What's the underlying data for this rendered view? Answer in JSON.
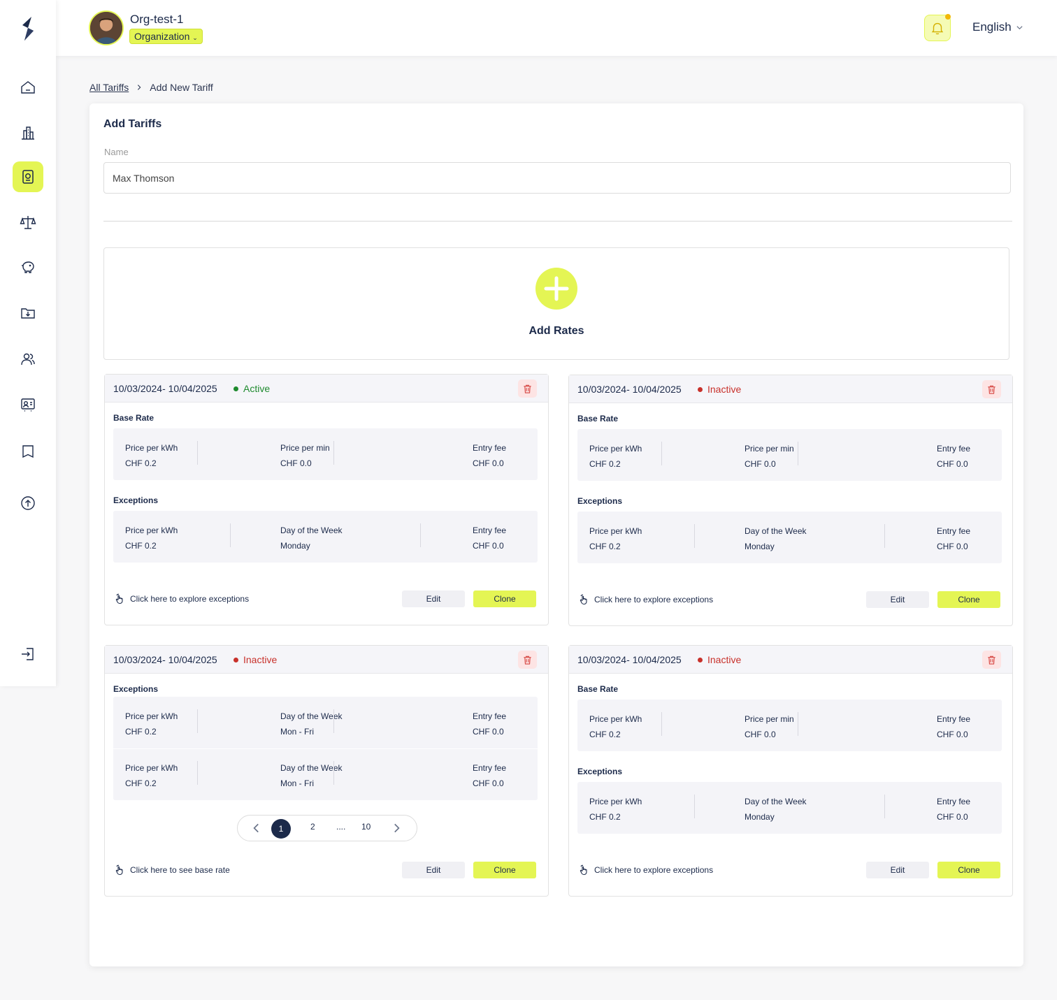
{
  "header": {
    "org_name": "Org-test-1",
    "org_type": "Organization",
    "language": "English"
  },
  "breadcrumb": {
    "parent": "All Tariffs",
    "current": "Add New Tariff"
  },
  "form": {
    "title": "Add Tariffs",
    "name_label": "Name",
    "name_value": "Max Thomson",
    "add_rates_label": "Add Rates"
  },
  "colors": {
    "accent": "#e4f554",
    "navy": "#1c2a4a",
    "active": "#1e8a2e",
    "inactive": "#c8312b"
  },
  "cards": [
    {
      "date_range": "10/03/2024- 10/04/2025",
      "status": "Active",
      "base_rate": {
        "label": "Base Rate",
        "col1_label": "Price per kWh",
        "col1_value": "CHF 0.2",
        "col2_label": "Price per min",
        "col2_value": "CHF 0.0",
        "col3_label": "Entry fee",
        "col3_value": "CHF 0.0"
      },
      "exceptions": {
        "label": "Exceptions",
        "col1_label": "Price per kWh",
        "col1_value": "CHF 0.2",
        "col2_label": "Day of the Week",
        "col2_value": "Monday",
        "col3_label": "Entry fee",
        "col3_value": "CHF 0.0"
      },
      "link_text": "Click here to explore exceptions",
      "edit_label": "Edit",
      "clone_label": "Clone"
    },
    {
      "date_range": "10/03/2024- 10/04/2025",
      "status": "Inactive",
      "base_rate": {
        "label": "Base Rate",
        "col1_label": "Price per kWh",
        "col1_value": "CHF 0.2",
        "col2_label": "Price per min",
        "col2_value": "CHF 0.0",
        "col3_label": "Entry fee",
        "col3_value": "CHF 0.0"
      },
      "exceptions": {
        "label": "Exceptions",
        "col1_label": "Price per kWh",
        "col1_value": "CHF 0.2",
        "col2_label": "Day of the Week",
        "col2_value": "Monday",
        "col3_label": "Entry fee",
        "col3_value": "CHF 0.0"
      },
      "link_text": "Click here to explore exceptions",
      "edit_label": "Edit",
      "clone_label": "Clone"
    },
    {
      "date_range": "10/03/2024- 10/04/2025",
      "status": "Inactive",
      "exceptions_label": "Exceptions",
      "exception_rows": [
        {
          "col1_label": "Price per kWh",
          "col1_value": "CHF 0.2",
          "col2_label": "Day of the Week",
          "col2_value": "Mon - Fri",
          "col3_label": "Entry fee",
          "col3_value": "CHF 0.0"
        },
        {
          "col1_label": "Price per kWh",
          "col1_value": "CHF 0.2",
          "col2_label": "Day of the Week",
          "col2_value": "Mon - Fri",
          "col3_label": "Entry fee",
          "col3_value": "CHF 0.0"
        }
      ],
      "pagination": {
        "current": "1",
        "next": "2",
        "ellipsis": "....",
        "last": "10"
      },
      "link_text": "Click here to see base rate",
      "edit_label": "Edit",
      "clone_label": "Clone"
    },
    {
      "date_range": "10/03/2024- 10/04/2025",
      "status": "Inactive",
      "base_rate": {
        "label": "Base Rate",
        "col1_label": "Price per kWh",
        "col1_value": "CHF 0.2",
        "col2_label": "Price per min",
        "col2_value": "CHF 0.0",
        "col3_label": "Entry fee",
        "col3_value": "CHF 0.0"
      },
      "exceptions": {
        "label": "Exceptions",
        "col1_label": "Price per kWh",
        "col1_value": "CHF 0.2",
        "col2_label": "Day of the Week",
        "col2_value": "Monday",
        "col3_label": "Entry fee",
        "col3_value": "CHF 0.0"
      },
      "link_text": "Click here to explore exceptions",
      "edit_label": "Edit",
      "clone_label": "Clone"
    }
  ],
  "sidebar": {
    "items": [
      {
        "icon": "home-icon"
      },
      {
        "icon": "building-icon"
      },
      {
        "icon": "charger-icon",
        "active": true
      },
      {
        "icon": "scale-icon"
      },
      {
        "icon": "piggy-bank-icon"
      },
      {
        "icon": "folder-download-icon"
      },
      {
        "icon": "users-icon"
      },
      {
        "icon": "user-card-icon"
      },
      {
        "icon": "book-icon"
      },
      {
        "icon": "upload-icon"
      },
      {
        "icon": "logout-icon"
      }
    ]
  }
}
